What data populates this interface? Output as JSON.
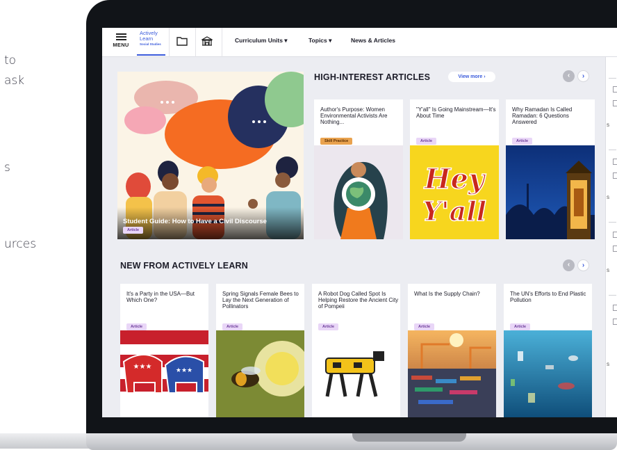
{
  "side_text": [
    "to",
    "ask",
    "",
    "s",
    "urces"
  ],
  "nav": {
    "menu_label": "MENU",
    "logo": {
      "line1": "Actively",
      "line2": "Learn",
      "line3": "Social Studies"
    },
    "items": [
      {
        "label": "Curriculum Units ▾"
      },
      {
        "label": "Topics ▾"
      },
      {
        "label": "News & Articles"
      }
    ]
  },
  "featured": {
    "title": "Student Guide: How to Have a Civil Discourse",
    "badge": "Article"
  },
  "high_interest": {
    "heading": "HIGH-INTEREST ARTICLES",
    "view_more": "View more  ›",
    "cards": [
      {
        "title": "Author's Purpose: Women Environmental Activists Are Nothing...",
        "badge": "Skill Practice",
        "badge_type": "skill"
      },
      {
        "title": "\"Y'all\" Is Going Mainstream—It's About Time",
        "badge": "Article",
        "badge_type": "article"
      },
      {
        "title": "Why Ramadan Is Called Ramadan: 6 Questions Answered",
        "badge": "Article",
        "badge_type": "article"
      }
    ],
    "hey_yall_text": [
      "Hey",
      "Y'all"
    ]
  },
  "new_from": {
    "heading": "NEW FROM ACTIVELY LEARN",
    "cards": [
      {
        "title": "It's a Party in the USA—But Which One?",
        "badge": "Article"
      },
      {
        "title": "Spring Signals Female Bees to Lay the Next Generation of Pollinators",
        "badge": "Article"
      },
      {
        "title": "A Robot Dog Called Spot Is Helping Restore the Ancient City of Pompeii",
        "badge": "Article"
      },
      {
        "title": "What Is the Supply Chain?",
        "badge": "Article"
      },
      {
        "title": "The UN's Efforts to End Plastic Pollution",
        "badge": "Article"
      }
    ]
  },
  "arrows": {
    "prev": "‹",
    "next": "›"
  },
  "rail_letters": [
    "S",
    "S",
    "S",
    "S"
  ],
  "colors": {
    "accent": "#3b5bdb",
    "badge_article": "#e9d6f7",
    "badge_skill": "#e9a24e",
    "screen_bg": "#ecedf2"
  }
}
